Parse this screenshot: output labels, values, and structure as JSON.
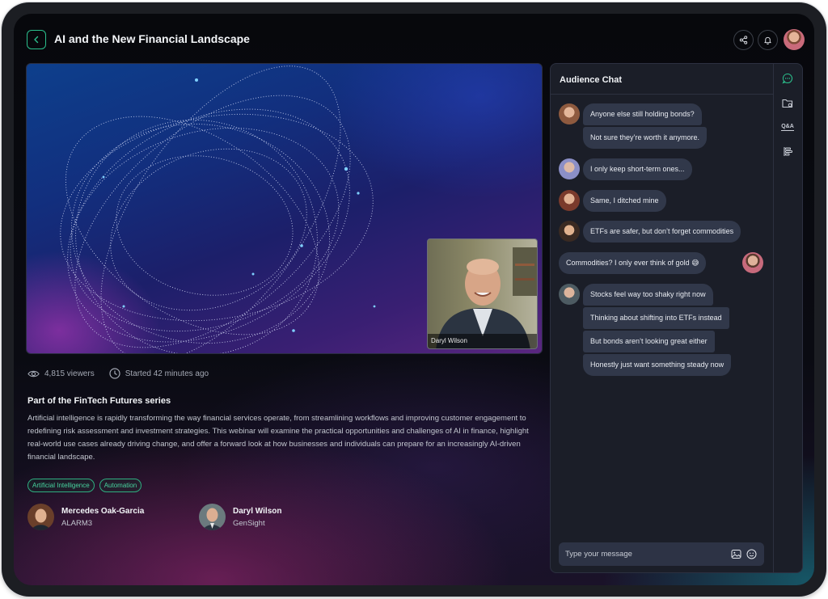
{
  "header": {
    "title": "AI and the New Financial Landscape",
    "back_icon": "chevron-left-icon",
    "share_icon": "share-icon",
    "bell_icon": "bell-icon",
    "accent": "#2bbf8c"
  },
  "video": {
    "pip_name": "Daryl Wilson"
  },
  "stats": {
    "viewers": "4,815 viewers",
    "started": "Started 42 minutes ago"
  },
  "about": {
    "series": "Part of the FinTech Futures series",
    "description": "Artificial intelligence is rapidly transforming the way financial services operate, from streamlining workflows and improving customer engagement to redefining risk assessment and investment strategies. This webinar will examine the practical opportunities and challenges of AI in finance, highlight real-world use cases already driving change, and offer a forward look at how businesses and individuals can prepare for an increasingly AI-driven financial landscape.",
    "tags": [
      "Artificial Intelligence",
      "Automation"
    ]
  },
  "speakers": [
    {
      "name": "Mercedes Oak-Garcia",
      "org": "ALARM3"
    },
    {
      "name": "Daryl Wilson",
      "org": "GenSight"
    }
  ],
  "chat": {
    "title": "Audience Chat",
    "rail_icons": [
      "chat-icon",
      "folder-icon",
      "qa-icon",
      "outline-icon"
    ],
    "rail_qa_label": "Q&A",
    "messages": [
      "Anyone else still holding bonds?",
      "Not sure they’re worth it anymore.",
      "I only keep short-term ones...",
      "Same, I ditched mine",
      "ETFs are safer, but don’t forget commodities",
      "Commodities? I only ever think of gold 😅",
      "Stocks feel way too shaky right now",
      "Thinking about shifting into ETFs instead",
      "But bonds aren’t looking great either",
      "Honestly just want something steady now"
    ],
    "composer_placeholder": "Type your message"
  }
}
